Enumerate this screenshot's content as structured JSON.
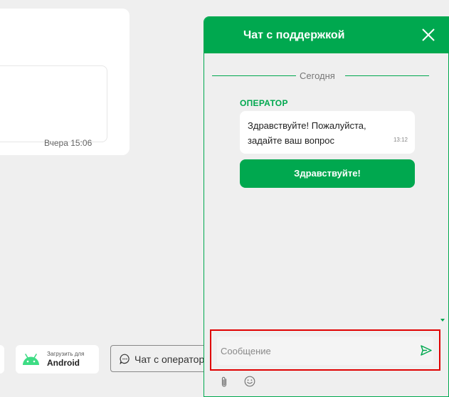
{
  "background": {
    "message_time": "Вчера 15:06",
    "store_badge": {
      "subtitle": "Загрузить для",
      "title": "Android",
      "icon": "android-icon"
    },
    "chat_button": {
      "label": "Чат с оператором",
      "icon": "chat-bubble-icon"
    }
  },
  "chat": {
    "title": "Чат с поддержкой",
    "close_icon": "close-icon",
    "date_divider": "Сегодня",
    "operator_label": "ОПЕРАТОР",
    "messages": [
      {
        "text": "Здравствуйте! Пожалуйста, задайте ваш вопрос",
        "time": "13:12"
      }
    ],
    "quick_reply": "Здравствуйте!",
    "input": {
      "placeholder": "Сообщение",
      "value": ""
    },
    "icons": {
      "send": "send-icon",
      "attach": "paperclip-icon",
      "emoji": "emoji-icon"
    },
    "colors": {
      "accent": "#00a84f",
      "highlight": "#e00000"
    }
  }
}
